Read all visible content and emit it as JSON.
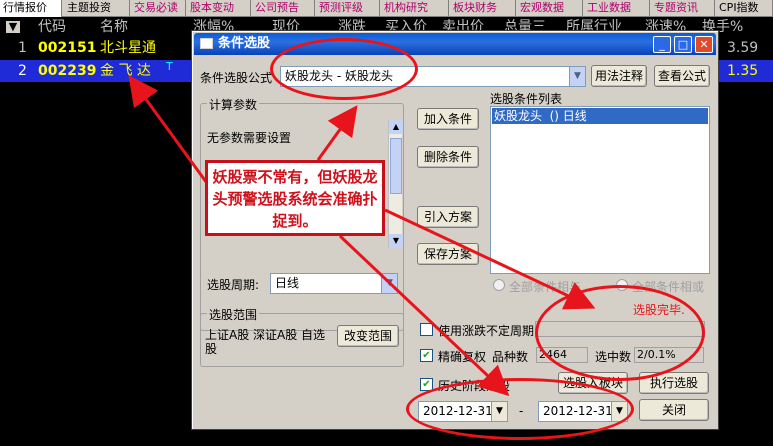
{
  "tabs": [
    "行情报价",
    "主题投资",
    "交易必读",
    "股本变动",
    "公司预告",
    "预测评级",
    "机构研究",
    "板块财务",
    "宏观数据",
    "工业数据",
    "专题资讯",
    "CPI指数"
  ],
  "table": {
    "headers": [
      "▼",
      "代码",
      "名称",
      "涨幅%",
      "现价",
      "涨跌",
      "买入价",
      "卖出价",
      "总量三",
      "所属行业",
      "涨速%",
      "换手%"
    ],
    "rows": [
      {
        "idx": "1",
        "code": "002151",
        "name": "北斗星通",
        "turnover": "3.59"
      },
      {
        "idx": "2",
        "code": "002239",
        "name": "金 飞 达",
        "mark": "T",
        "turnover": "1.35"
      }
    ]
  },
  "dialog": {
    "title": "条件选股",
    "formula_label": "条件选股公式",
    "formula_value": "妖股龙头 - 妖股龙头",
    "usage_btn": "用法注释",
    "view_formula_btn": "查看公式",
    "params_group": "计算参数",
    "params_text": "无参数需要设置",
    "add_btn": "加入条件",
    "delete_btn": "删除条件",
    "import_btn": "引入方案",
    "save_btn": "保存方案",
    "list_label": "选股条件列表",
    "list_item": "妖股龙头  () 日线",
    "period_label": "选股周期:",
    "period_value": "日线",
    "radio_and": "全部条件相与",
    "radio_or": "全部条件相或",
    "done_text": "选股完毕.",
    "range_group": "选股范围",
    "range_text": "上证A股  深证A股  自选股",
    "change_range_btn": "改变范围",
    "chk_uncertain": "使用涨跌不定周期",
    "chk_exact": "精确复权",
    "count_label": "品种数",
    "count_value": "2464",
    "hit_label": "选中数",
    "hit_value": "2/0.1%",
    "chk_history": "历史阶段选股",
    "to_block_btn": "选股入板块",
    "exec_btn": "执行选股",
    "date_from": "2012-12-31",
    "date_sep": "-",
    "date_to": "2012-12-31",
    "close_btn": "关闭"
  },
  "annotation": "妖股票不常有，但妖股龙头预警选股系统会准确扑捉到。",
  "colors": {
    "accent_red": "#e8141c",
    "code_yellow": "#ffff00",
    "select_blue": "#1f2bd6"
  }
}
